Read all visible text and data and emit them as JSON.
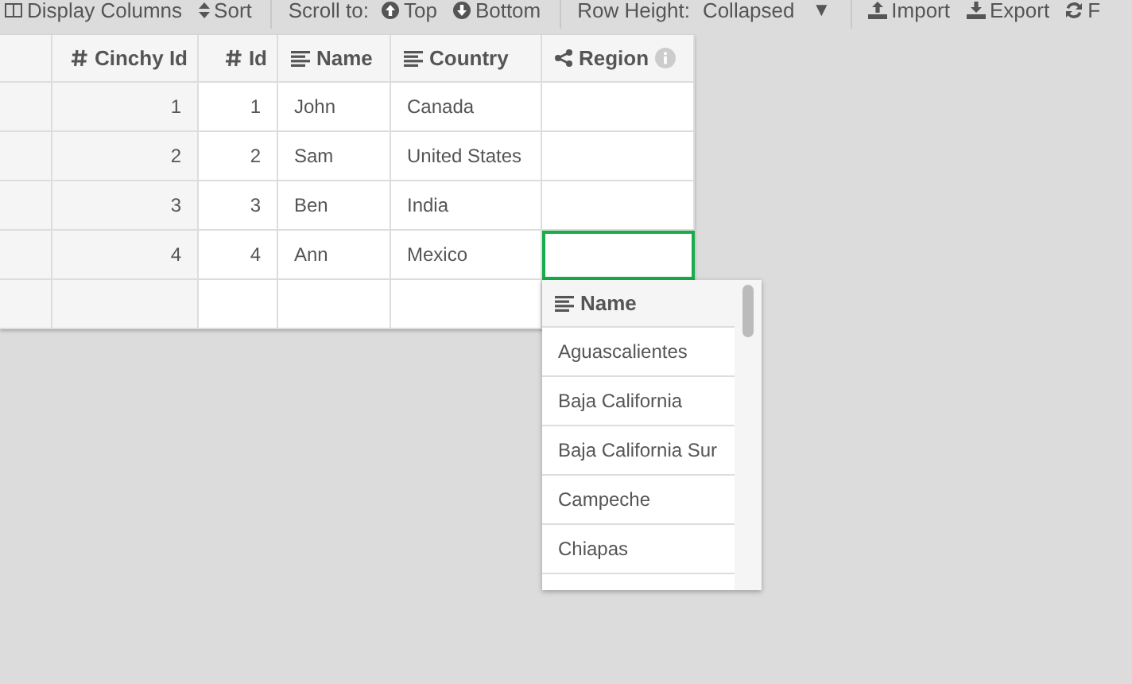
{
  "toolbar": {
    "items": [
      {
        "kind": "columns",
        "label": "Display Columns"
      },
      {
        "kind": "sort",
        "label": "Sort"
      },
      {
        "kind": "divider"
      },
      {
        "kind": "text",
        "label": "Scroll to:"
      },
      {
        "kind": "up",
        "label": "Top"
      },
      {
        "kind": "down",
        "label": "Bottom"
      },
      {
        "kind": "divider"
      },
      {
        "kind": "text",
        "label": "Row Height:"
      },
      {
        "kind": "dropdown",
        "label": "Collapsed",
        "caret": "▼"
      },
      {
        "kind": "divider"
      },
      {
        "kind": "import",
        "label": "Import"
      },
      {
        "kind": "export",
        "label": "Export"
      },
      {
        "kind": "refresh",
        "label": "F"
      }
    ]
  },
  "table": {
    "columns": [
      {
        "kind": "number",
        "label": "Cinchy Id"
      },
      {
        "kind": "number",
        "label": "Id"
      },
      {
        "kind": "text",
        "label": "Name"
      },
      {
        "kind": "text",
        "label": "Country"
      },
      {
        "kind": "link",
        "label": "Region",
        "info": true
      }
    ],
    "rows": [
      {
        "cells": [
          "1",
          "1",
          "John",
          "Canada",
          ""
        ],
        "selected": false
      },
      {
        "cells": [
          "2",
          "2",
          "Sam",
          "United States",
          ""
        ],
        "selected": false
      },
      {
        "cells": [
          "3",
          "3",
          "Ben",
          "India",
          ""
        ],
        "selected": false
      },
      {
        "cells": [
          "4",
          "4",
          "Ann",
          "Mexico",
          ""
        ],
        "selected": true
      }
    ]
  },
  "dropdown": {
    "header": "Name",
    "items": [
      "Aguascalientes",
      "Baja California",
      "Baja California Sur",
      "Campeche",
      "Chiapas"
    ]
  }
}
